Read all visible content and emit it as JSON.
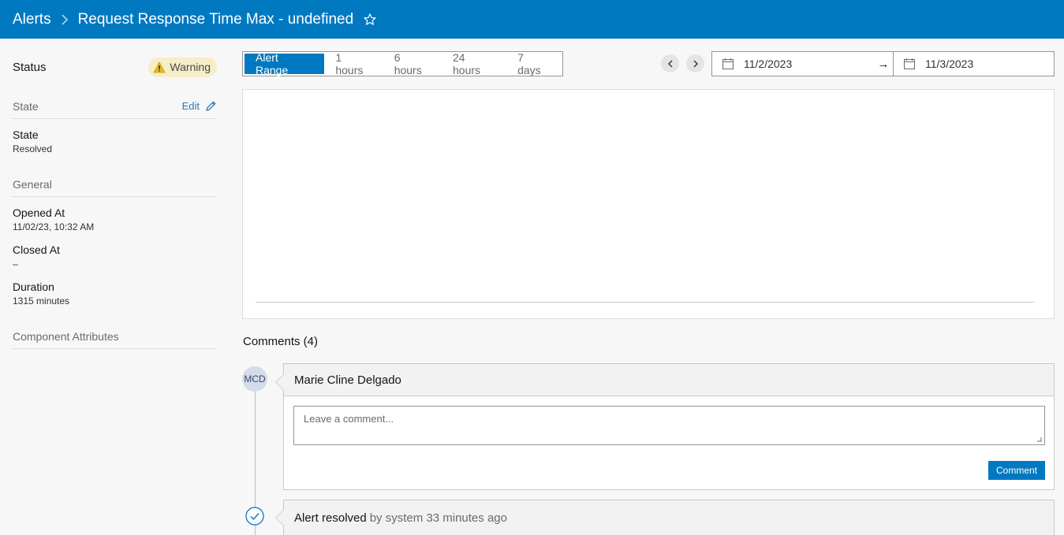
{
  "header": {
    "breadcrumb_root": "Alerts",
    "title": "Request Response Time Max - undefined"
  },
  "sidebar": {
    "status_label": "Status",
    "status_badge": "Warning",
    "state_section": "State",
    "edit_label": "Edit",
    "state_field_label": "State",
    "state_field_value": "Resolved",
    "general_section": "General",
    "opened_label": "Opened At",
    "opened_value": "11/02/23, 10:32 AM",
    "closed_label": "Closed At",
    "closed_value": "–",
    "duration_label": "Duration",
    "duration_value": "1315 minutes",
    "component_section": "Component Attributes"
  },
  "range": {
    "options": [
      "Alert Range",
      "1 hours",
      "6 hours",
      "24 hours",
      "7 days"
    ],
    "selected": "Alert Range"
  },
  "dates": {
    "start": "11/2/2023",
    "arrow": "→",
    "end": "11/3/2023"
  },
  "comments": {
    "title": "Comments (4)",
    "avatar_initials": "MCD",
    "author": "Marie Cline Delgado",
    "placeholder": "Leave a comment...",
    "submit_label": "Comment"
  },
  "events": [
    {
      "text": "Alert resolved",
      "meta": "by system 33 minutes ago"
    }
  ],
  "colors": {
    "brand": "#0079c1",
    "warning": "#f6eec6"
  }
}
